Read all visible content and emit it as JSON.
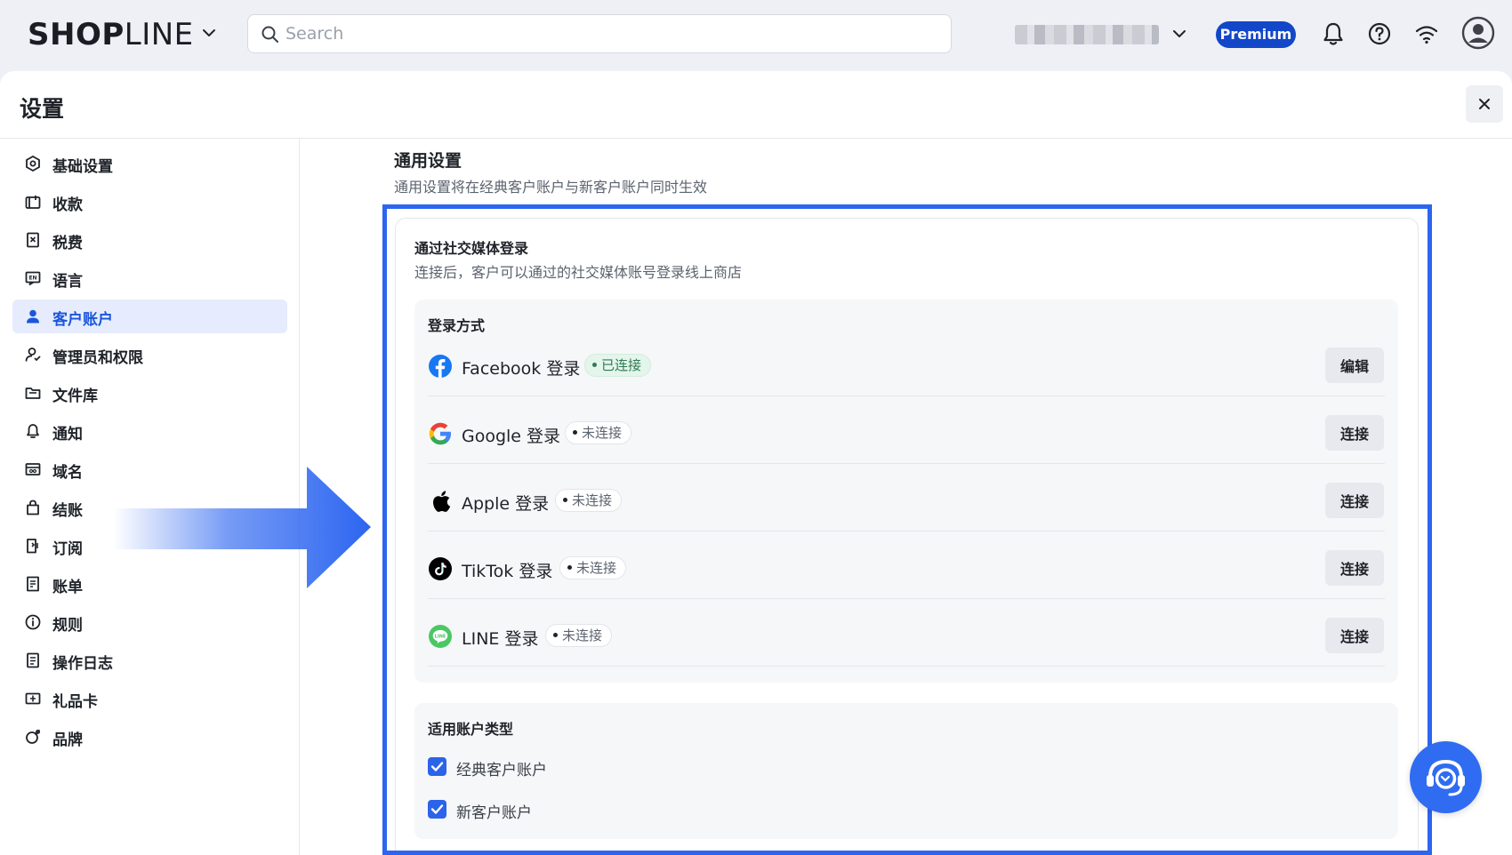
{
  "topbar": {
    "logo_bold": "SHOP",
    "logo_thin": "LINE",
    "search_placeholder": "Search",
    "premium_label": "Premium"
  },
  "page": {
    "title": "设置",
    "close_label": "×"
  },
  "sidebar": {
    "items": [
      {
        "label": "基础设置",
        "icon": "settings-hex-icon"
      },
      {
        "label": "收款",
        "icon": "wallet-icon"
      },
      {
        "label": "税费",
        "icon": "tax-icon"
      },
      {
        "label": "语言",
        "icon": "language-icon"
      },
      {
        "label": "客户账户",
        "icon": "user-icon",
        "active": true
      },
      {
        "label": "管理员和权限",
        "icon": "admin-icon"
      },
      {
        "label": "文件库",
        "icon": "folder-icon"
      },
      {
        "label": "通知",
        "icon": "bell-icon"
      },
      {
        "label": "域名",
        "icon": "domain-icon"
      },
      {
        "label": "结账",
        "icon": "bag-icon"
      },
      {
        "label": "订阅",
        "icon": "subscribe-icon"
      },
      {
        "label": "账单",
        "icon": "bill-icon"
      },
      {
        "label": "规则",
        "icon": "info-icon"
      },
      {
        "label": "操作日志",
        "icon": "log-icon"
      },
      {
        "label": "礼品卡",
        "icon": "gift-card-icon"
      },
      {
        "label": "品牌",
        "icon": "brand-icon"
      }
    ]
  },
  "content": {
    "section_title": "通用设置",
    "section_subtitle": "通用设置将在经典客户账户与新客户账户同时生效",
    "card_title": "通过社交媒体登录",
    "card_subtitle": "连接后，客户可以通过的社交媒体账号登录线上商店",
    "login_methods_title": "登录方式",
    "logins": [
      {
        "name": "Facebook 登录",
        "status": "已连接",
        "connected": true,
        "button": "编辑"
      },
      {
        "name": "Google 登录",
        "status": "未连接",
        "connected": false,
        "button": "连接"
      },
      {
        "name": "Apple 登录",
        "status": "未连接",
        "connected": false,
        "button": "连接"
      },
      {
        "name": "TikTok 登录",
        "status": "未连接",
        "connected": false,
        "button": "连接"
      },
      {
        "name": "LINE 登录",
        "status": "未连接",
        "connected": false,
        "button": "连接"
      }
    ],
    "account_types_title": "适用账户类型",
    "account_types": [
      {
        "label": "经典客户账户",
        "checked": true
      },
      {
        "label": "新客户账户",
        "checked": true
      }
    ]
  },
  "colors": {
    "accent": "#2c65f0",
    "premium": "#1247c9",
    "connected": "#2f7a52"
  }
}
